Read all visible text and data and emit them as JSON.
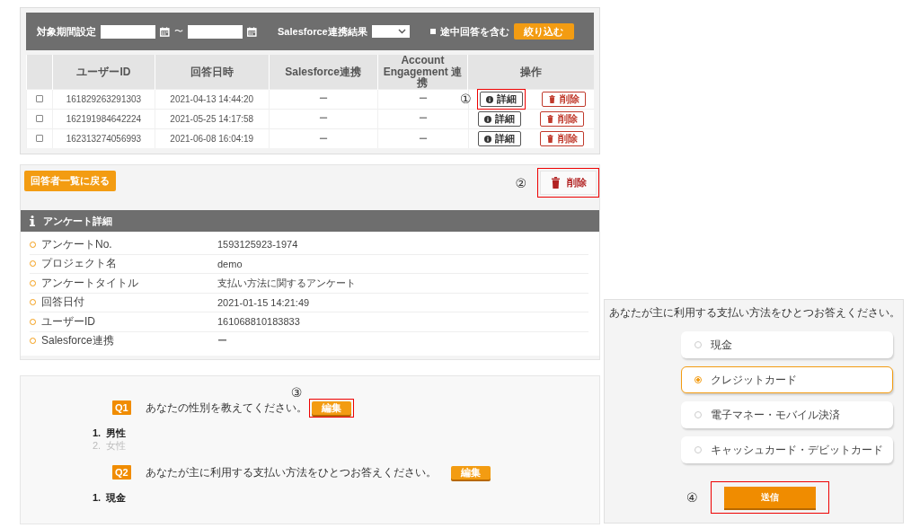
{
  "filter": {
    "period_label": "対象期間設定",
    "range_separator": "〜",
    "sf_label": "Salesforce連携結果",
    "include_label": "途中回答を含む",
    "include_checked": false,
    "button": "絞り込む"
  },
  "table": {
    "columns": [
      "ユーザーID",
      "回答日時",
      "Salesforce連携",
      "Account Engagement 連携",
      "操作"
    ],
    "rows": [
      {
        "checked": false,
        "user_id": "161829263291303",
        "date": "2021-04-13 14:44:20",
        "salesforce": "ー",
        "account_engagement": "ー",
        "detail": "詳細",
        "delete": "削除",
        "annotation": "①"
      },
      {
        "checked": false,
        "user_id": "162191984642224",
        "date": "2021-05-25 14:17:58",
        "salesforce": "ー",
        "account_engagement": "ー",
        "detail": "詳細",
        "delete": "削除"
      },
      {
        "checked": false,
        "user_id": "162313274056993",
        "date": "2021-06-08 16:04:19",
        "salesforce": "ー",
        "account_engagement": "ー",
        "detail": "詳細",
        "delete": "削除"
      }
    ]
  },
  "detail_page": {
    "back_button": "回答者一覧に戻る",
    "annotation": "②",
    "delete_button": "削除",
    "section_title": "アンケート詳細",
    "fields": [
      {
        "label": "アンケートNo.",
        "value": "1593125923-1974"
      },
      {
        "label": "プロジェクト名",
        "value": "demo"
      },
      {
        "label": "アンケートタイトル",
        "value": "支払い方法に関するアンケート"
      },
      {
        "label": "回答日付",
        "value": "2021-01-15 14:21:49"
      },
      {
        "label": "ユーザーID",
        "value": "161068810183833"
      },
      {
        "label": "Salesforce連携",
        "value": "ー"
      }
    ]
  },
  "answers": {
    "questions": [
      {
        "badge": "Q1",
        "text": "あなたの性別を教えてください。",
        "edit": "編集",
        "annotation": "③",
        "options": [
          {
            "number": "1.",
            "label": "男性",
            "selected": true
          },
          {
            "number": "2.",
            "label": "女性",
            "selected": false
          }
        ]
      },
      {
        "badge": "Q2",
        "text": "あなたが主に利用する支払い方法をひとつお答えください。",
        "edit": "編集",
        "options": [
          {
            "number": "1.",
            "label": "現金",
            "selected": true
          }
        ]
      }
    ]
  },
  "form_preview": {
    "question": "あなたが主に利用する支払い方法をひとつお答えください。",
    "options": [
      {
        "label": "現金",
        "selected": false
      },
      {
        "label": "クレジットカード",
        "selected": true
      },
      {
        "label": "電子マネー・モバイル決済",
        "selected": false
      },
      {
        "label": "キャッシュカード・デビットカード",
        "selected": false
      }
    ],
    "submit": "送信",
    "annotation": "④"
  }
}
